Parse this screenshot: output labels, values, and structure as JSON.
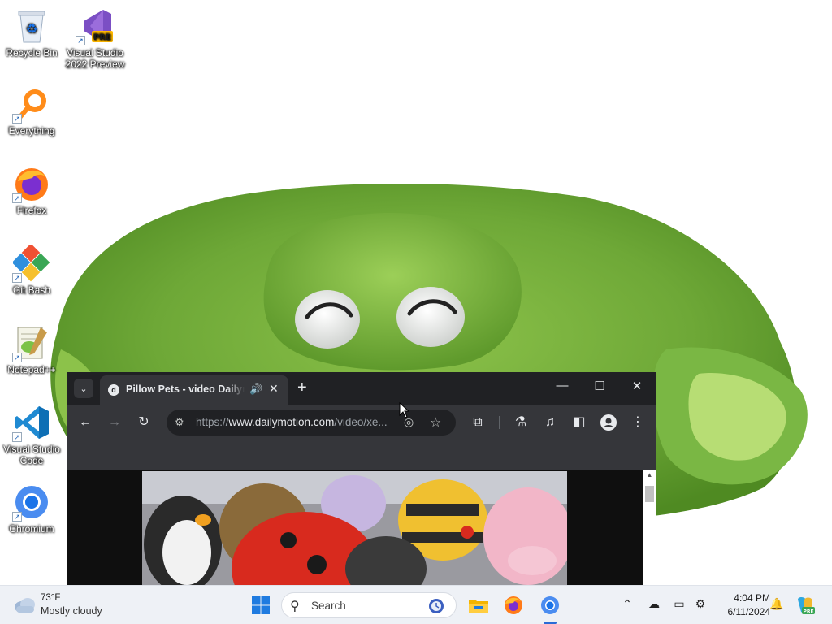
{
  "desktop": {
    "icons": [
      {
        "label": "Recycle Bin",
        "icon": "recycle-bin-icon"
      },
      {
        "label": "Visual Studio 2022 Preview",
        "icon": "visual-studio-preview-icon",
        "badge": "PRE"
      },
      {
        "label": "Everything",
        "icon": "everything-search-icon"
      },
      {
        "label": "Firefox",
        "icon": "firefox-icon"
      },
      {
        "label": "Git Bash",
        "icon": "git-bash-icon"
      },
      {
        "label": "Notepad++",
        "icon": "notepad-plus-plus-icon"
      },
      {
        "label": "Visual Studio Code",
        "icon": "vscode-icon"
      },
      {
        "label": "Chromium",
        "icon": "chromium-icon"
      }
    ]
  },
  "browser": {
    "tab": {
      "title": "Pillow Pets - video Dailymotion",
      "favicon": "dailymotion-icon",
      "audio_icon": "speaker-icon",
      "close_glyph": "✕"
    },
    "new_tab_glyph": "+",
    "window_controls": {
      "minimize": "—",
      "maximize": "☐",
      "close": "✕"
    },
    "toolbar": {
      "back": "←",
      "forward": "→",
      "reload": "↻",
      "menu": "⋮"
    },
    "omnibox": {
      "url_prefix": "https://",
      "host": "www.dailymotion.com",
      "path": "/video/xe..."
    },
    "toolbar_icons": [
      "extensions-icon",
      "labs-flask-icon",
      "media-control-icon",
      "side-panel-icon",
      "profile-icon",
      "menu-icon"
    ]
  },
  "taskbar": {
    "weather": {
      "temp": "73°F",
      "desc": "Mostly cloudy"
    },
    "search_label": "Search",
    "pinned": [
      "windows-start-icon",
      "search-icon",
      "file-explorer-icon",
      "firefox-icon",
      "chromium-icon"
    ],
    "tray_icons": [
      "chevron-up-icon",
      "onedrive-offline-icon",
      "display-icon",
      "network-icon",
      "notification-bell-icon",
      "copilot-icon"
    ],
    "clock": {
      "time": "4:04 PM",
      "date": "6/11/2024"
    }
  },
  "colors": {
    "browser_frame": "#202124",
    "browser_toolbar": "#35363a",
    "taskbar": "#eef1f6",
    "plush_green": "#6fa83a"
  }
}
